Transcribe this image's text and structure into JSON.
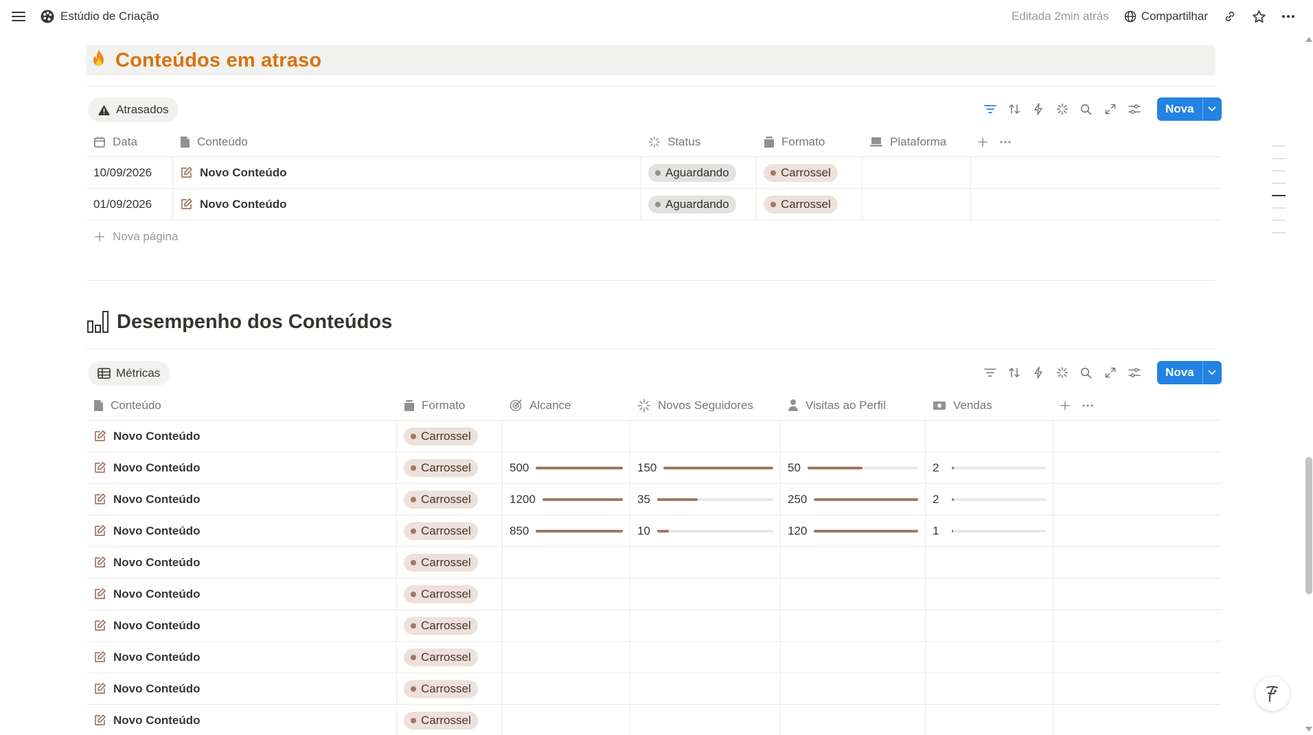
{
  "topbar": {
    "page_title": "Estúdio de Criação",
    "edited": "Editada 2min atrás",
    "share_label": "Compartilhar"
  },
  "section1": {
    "title": "Conteúdos em atraso",
    "icon": "fire-emoji",
    "view_tab": "Atrasados",
    "new_button": "Nova",
    "columns": [
      "Data",
      "Conteúdo",
      "Status",
      "Formato",
      "Plataforma"
    ],
    "rows": [
      {
        "date": "10/09/2026",
        "title": "Novo Conteúdo",
        "status": "Aguardando",
        "format": "Carrossel",
        "platform": ""
      },
      {
        "date": "01/09/2026",
        "title": "Novo Conteúdo",
        "status": "Aguardando",
        "format": "Carrossel",
        "platform": ""
      }
    ],
    "new_page": "Nova página"
  },
  "section2": {
    "title": "Desempenho dos Conteúdos",
    "icon": "bar-chart-icon",
    "view_tab": "Métricas",
    "new_button": "Nova",
    "columns": [
      "Conteúdo",
      "Formato",
      "Alcance",
      "Novos Seguidores",
      "Visitas ao Perfil",
      "Vendas"
    ],
    "rows": [
      {
        "title": "Novo Conteúdo",
        "format": "Carrossel",
        "alcance": null,
        "seguidores": null,
        "visitas": null,
        "vendas": null
      },
      {
        "title": "Novo Conteúdo",
        "format": "Carrossel",
        "alcance": 500,
        "seguidores": 150,
        "visitas": 50,
        "vendas": 2
      },
      {
        "title": "Novo Conteúdo",
        "format": "Carrossel",
        "alcance": 1200,
        "seguidores": 35,
        "visitas": 250,
        "vendas": 2
      },
      {
        "title": "Novo Conteúdo",
        "format": "Carrossel",
        "alcance": 850,
        "seguidores": 10,
        "visitas": 120,
        "vendas": 1
      },
      {
        "title": "Novo Conteúdo",
        "format": "Carrossel",
        "alcance": null,
        "seguidores": null,
        "visitas": null,
        "vendas": null
      },
      {
        "title": "Novo Conteúdo",
        "format": "Carrossel",
        "alcance": null,
        "seguidores": null,
        "visitas": null,
        "vendas": null
      },
      {
        "title": "Novo Conteúdo",
        "format": "Carrossel",
        "alcance": null,
        "seguidores": null,
        "visitas": null,
        "vendas": null
      },
      {
        "title": "Novo Conteúdo",
        "format": "Carrossel",
        "alcance": null,
        "seguidores": null,
        "visitas": null,
        "vendas": null
      },
      {
        "title": "Novo Conteúdo",
        "format": "Carrossel",
        "alcance": null,
        "seguidores": null,
        "visitas": null,
        "vendas": null
      },
      {
        "title": "Novo Conteúdo",
        "format": "Carrossel",
        "alcance": null,
        "seguidores": null,
        "visitas": null,
        "vendas": null
      }
    ],
    "bar_fill": {
      "alcance": [
        1.0,
        1.0,
        1.0
      ],
      "seguidores": [
        1.0,
        0.35,
        0.1
      ],
      "visitas": [
        0.5,
        1.0,
        1.0
      ],
      "vendas": [
        0.02,
        0.02,
        0.01
      ]
    }
  },
  "colors": {
    "accent": "#2383e2",
    "callout_title": "#d9730d",
    "brown_bar": "#a27763"
  }
}
